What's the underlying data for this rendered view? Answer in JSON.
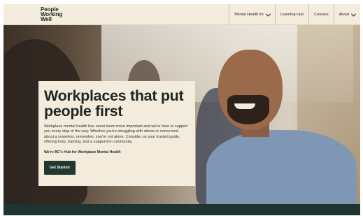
{
  "header": {
    "logo_lines": [
      "People",
      "Working",
      "Well"
    ],
    "nav": [
      {
        "label": "Mental Health for",
        "has_chevron": true
      },
      {
        "label": "Learning Hub",
        "has_chevron": false
      },
      {
        "label": "Courses",
        "has_chevron": false
      },
      {
        "label": "About",
        "has_chevron": true
      }
    ]
  },
  "hero": {
    "headline": "Workplaces that put people first",
    "body": "Workplace mental health has never been more important and we're here to support you every step of the way. Whether you're struggling with stress or concerned about a coworker, remember, you're not alone. Consider us your trusted guide, offering help, training, and a supportive community.",
    "hub_line": "We're BC's Hub for Workplace Mental Health",
    "cta_label": "Get Started"
  },
  "icons": {
    "dropdown": "chevron-down-icon"
  },
  "colors": {
    "header_bg": "#f4ecdc",
    "card_bg": "#f3ecdc",
    "button_bg": "#233731",
    "footer_band": "#1f3430",
    "text_dark": "#1f2623"
  }
}
